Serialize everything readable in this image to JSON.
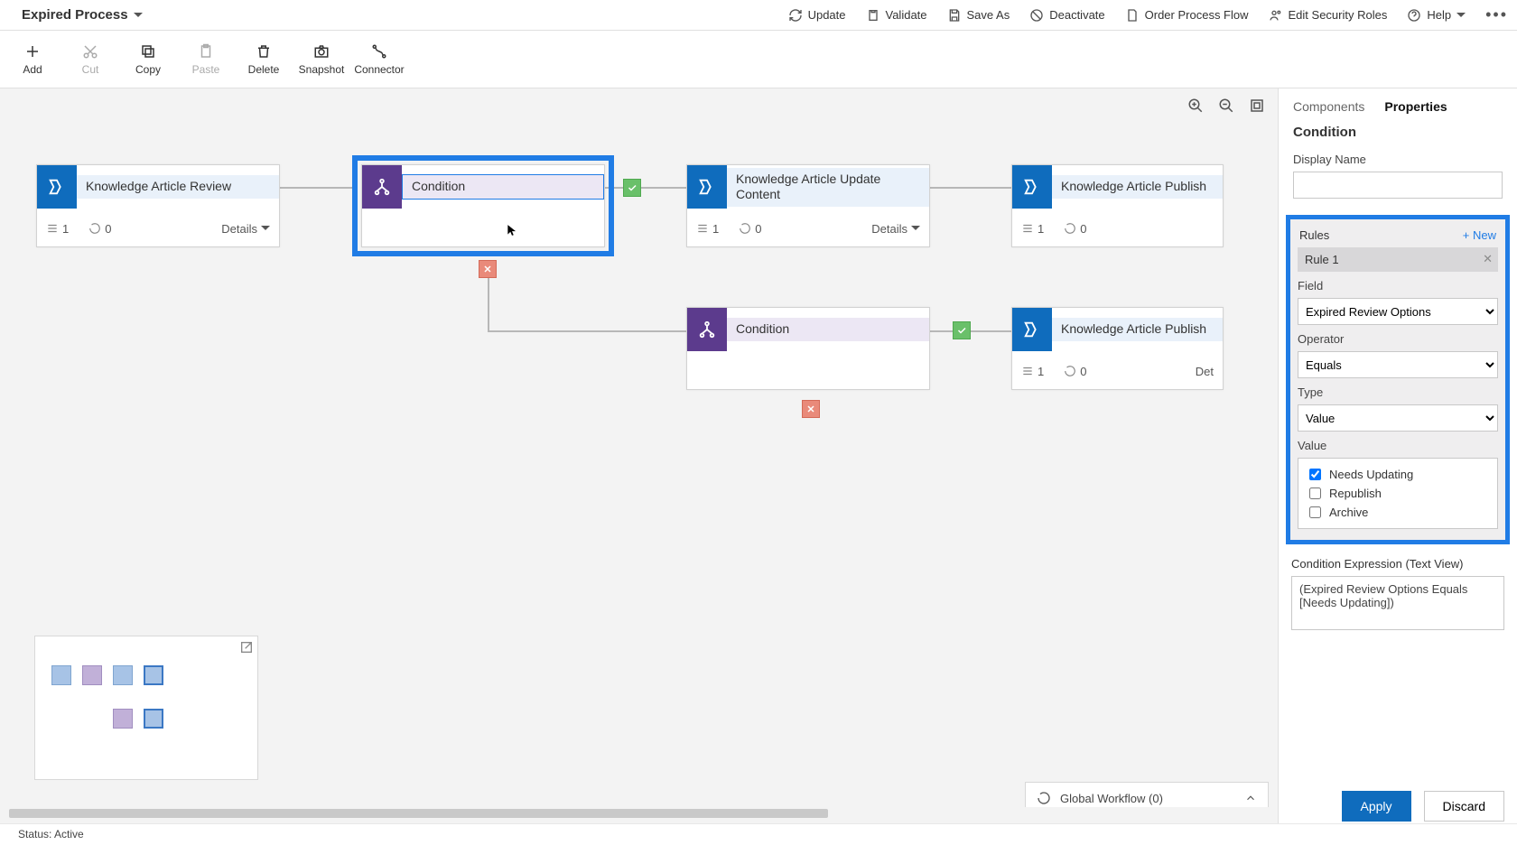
{
  "header": {
    "title": "Expired Process",
    "cmds": {
      "update": "Update",
      "validate": "Validate",
      "save_as": "Save As",
      "deactivate": "Deactivate",
      "order": "Order Process Flow",
      "edit_roles": "Edit Security Roles",
      "help": "Help"
    }
  },
  "ribbon": {
    "add": "Add",
    "cut": "Cut",
    "copy": "Copy",
    "paste": "Paste",
    "delete": "Delete",
    "snapshot": "Snapshot",
    "connector": "Connector"
  },
  "canvas": {
    "stages": {
      "s1": {
        "title": "Knowledge Article Review",
        "steps": "1",
        "loops": "0",
        "details": "Details"
      },
      "s2": {
        "title": "Knowledge Article Update Content",
        "steps": "1",
        "loops": "0",
        "details": "Details"
      },
      "s3": {
        "title": "Knowledge Article Publish",
        "steps": "1",
        "loops": "0"
      },
      "s4": {
        "title": "Knowledge Article Publish",
        "steps": "1",
        "loops": "0",
        "details": "Det"
      }
    },
    "conditions": {
      "c1": {
        "title": "Condition"
      },
      "c2": {
        "title": "Condition"
      }
    },
    "global_workflow": "Global Workflow (0)"
  },
  "panel": {
    "tabs": {
      "components": "Components",
      "properties": "Properties"
    },
    "section_title": "Condition",
    "display_name_label": "Display Name",
    "display_name_value": "",
    "rules_title": "Rules",
    "rules_new": "+ New",
    "rule1_label": "Rule 1",
    "field_label": "Field",
    "field_value": "Expired Review Options",
    "operator_label": "Operator",
    "operator_value": "Equals",
    "type_label": "Type",
    "type_value": "Value",
    "value_label": "Value",
    "value_options": {
      "needs_updating": "Needs Updating",
      "republish": "Republish",
      "archive": "Archive"
    },
    "expr_label": "Condition Expression (Text View)",
    "expr_value": "(Expired Review Options Equals [Needs Updating])",
    "apply": "Apply",
    "discard": "Discard"
  },
  "status": "Status: Active"
}
